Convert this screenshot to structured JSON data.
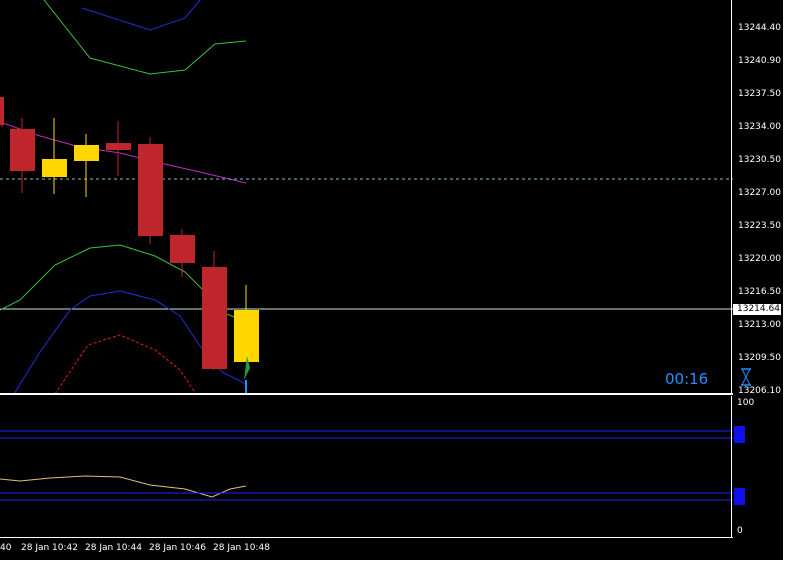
{
  "colors": {
    "background": "#000000",
    "bear_candle": "#c0272d",
    "bull_candle": "#ffd700",
    "ma_line": "#ba2fc0",
    "band_green": "#3fbf3f",
    "band_blue": "#1f2fd4",
    "band_red": "#d42020",
    "grid_dashed": "#7fbfbf",
    "level_blue": "#2020ff",
    "oscillator": "#e0c080",
    "timer_text": "#1e90ff"
  },
  "price_axis": {
    "ticks": [
      "13244.40",
      "13240.90",
      "13237.50",
      "13234.00",
      "13230.50",
      "13227.00",
      "13223.50",
      "13220.00",
      "13216.50",
      "13213.00",
      "13209.50",
      "13206.10"
    ],
    "current_price": "13214.64"
  },
  "time_axis": {
    "ticks": [
      "40",
      "28 Jan 10:42",
      "28 Jan 10:44",
      "28 Jan 10:46",
      "28 Jan 10:48"
    ]
  },
  "timer": {
    "text": "00:16",
    "icon": "hourglass-icon"
  },
  "indicator": {
    "max_label": "100",
    "min_label": "0"
  }
}
